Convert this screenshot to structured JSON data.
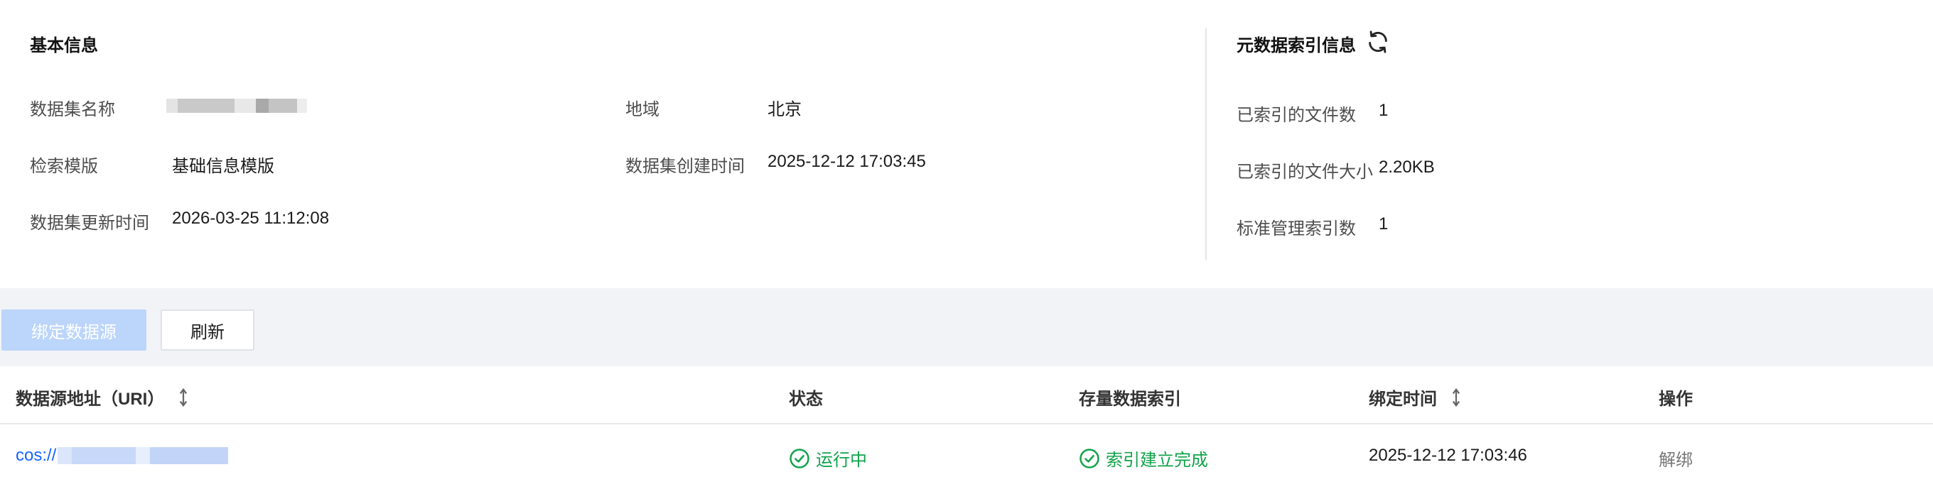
{
  "basic_info": {
    "title": "基本信息",
    "dataset_name_label": "数据集名称",
    "region_label": "地域",
    "region_value": "北京",
    "search_template_label": "检索模版",
    "search_template_value": "基础信息模版",
    "created_time_label": "数据集创建时间",
    "created_time_value": "2025-12-12 17:03:45",
    "updated_time_label": "数据集更新时间",
    "updated_time_value": "2026-03-25 11:12:08"
  },
  "metadata_index": {
    "title": "元数据索引信息",
    "indexed_file_count_label": "已索引的文件数",
    "indexed_file_count_value": "1",
    "indexed_file_size_label": "已索引的文件大小",
    "indexed_file_size_value": "2.20KB",
    "standard_index_count_label": "标准管理索引数",
    "standard_index_count_value": "1"
  },
  "toolbar": {
    "bind_label": "绑定数据源",
    "refresh_label": "刷新"
  },
  "table": {
    "columns": [
      "数据源地址（URI）",
      "状态",
      "存量数据索引",
      "绑定时间",
      "操作"
    ],
    "rows": [
      {
        "uri_prefix": "cos://",
        "status": "运行中",
        "index_status": "索引建立完成",
        "bind_time": "2025-12-12 17:03:46",
        "action": "解绑"
      }
    ]
  },
  "colors": {
    "primary": "#1664ff",
    "success": "#10a34a",
    "disabled_button": "#bcd5fb"
  },
  "icons": {
    "refresh": "refresh-icon",
    "sort": "sort-icon",
    "check": "check-circle-icon"
  }
}
